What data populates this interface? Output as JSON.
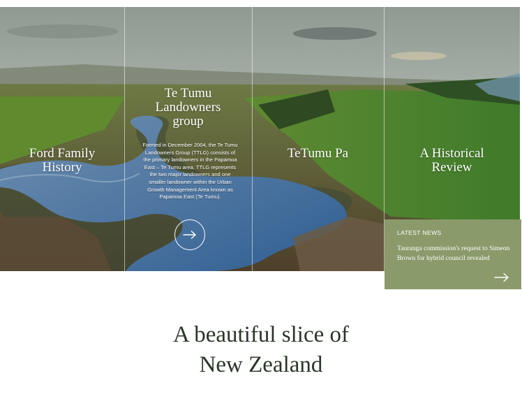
{
  "panels": [
    {
      "title_lines": [
        "Ford Family",
        "History"
      ]
    },
    {
      "title_lines": [
        "Te Tumu",
        "Landowners",
        "group"
      ],
      "body_lines": [
        "Formed in December 2004, the Te Tumu",
        "Landowners Group (TTLG) consists of",
        "the primary landowners in the Papamoa",
        "East – Te Tumu area. TTLG represents",
        "the two major landowners and one",
        "smaller landowner within the Urban",
        "Growth Management Area known as",
        "Papamoa East (Te Tumu)."
      ],
      "icon": "arrow-right-icon"
    },
    {
      "title_lines": [
        "TeTumu Pa"
      ]
    },
    {
      "title_lines": [
        "A Historical",
        "Review"
      ]
    }
  ],
  "news": {
    "heading": "LATEST NEWS",
    "text": "Tauranga commission's request to Simeon Brown for hybrid council revealed",
    "icon": "arrow-right-icon",
    "color": "#8a9a6b"
  },
  "headline": {
    "lines": [
      "A beautiful slice of",
      "New Zealand"
    ]
  }
}
